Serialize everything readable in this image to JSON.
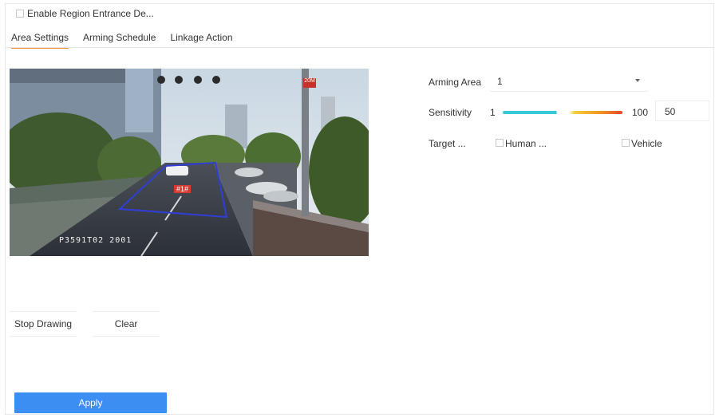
{
  "enable": {
    "label": "Enable Region Entrance De...",
    "checked": false
  },
  "tabs": [
    {
      "label": "Area Settings",
      "active": true
    },
    {
      "label": "Arming Schedule",
      "active": false
    },
    {
      "label": "Linkage Action",
      "active": false
    }
  ],
  "video": {
    "caption": "P3591T02   2001",
    "region_label": "#1#",
    "corner_tag": "20M"
  },
  "draw_buttons": {
    "stop": "Stop Drawing",
    "clear": "Clear"
  },
  "apply_label": "Apply",
  "settings": {
    "arming_area": {
      "label": "Arming Area",
      "value": "1"
    },
    "sensitivity": {
      "label": "Sensitivity",
      "min": "1",
      "max": "100",
      "value": "50"
    },
    "target": {
      "label": "Target ...",
      "options": [
        {
          "label": "Human ...",
          "checked": false
        },
        {
          "label": "Vehicle",
          "checked": false
        }
      ]
    }
  },
  "colors": {
    "accent": "#f08a24",
    "primary_button": "#3d8ef3",
    "region_outline": "#2f3fd6"
  }
}
